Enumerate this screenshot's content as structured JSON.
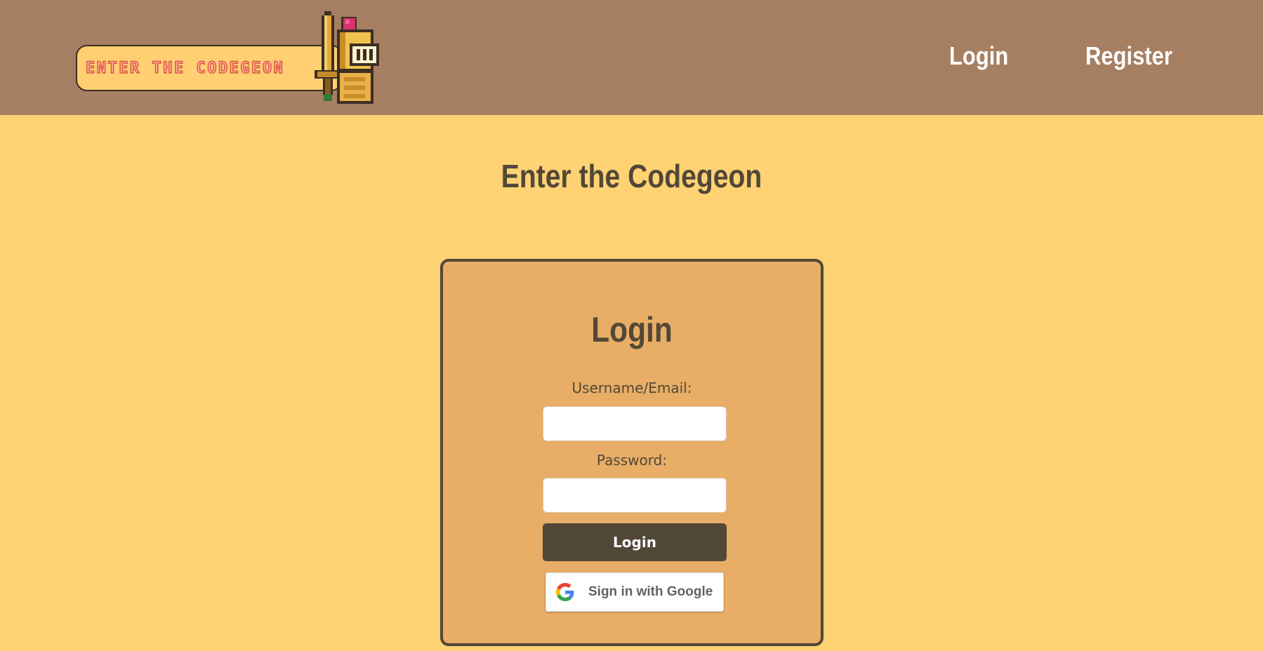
{
  "header": {
    "logo_text": "ENTER THE CODEGEON",
    "nav": {
      "login_label": "Login",
      "register_label": "Register"
    }
  },
  "main": {
    "title": "Enter the Codegeon"
  },
  "login_form": {
    "title": "Login",
    "username_label": "Username/Email:",
    "username_value": "",
    "password_label": "Password:",
    "password_value": "",
    "submit_label": "Login",
    "google_label": "Sign in with Google"
  },
  "colors": {
    "page_background": "#ffd274",
    "header_background": "#a67f62",
    "card_background": "#e8ad66",
    "dark_brown": "#524837",
    "logo_text": "#d9533b"
  },
  "icons": {
    "logo_mascot": "knight-icon",
    "google": "google-g-icon"
  }
}
